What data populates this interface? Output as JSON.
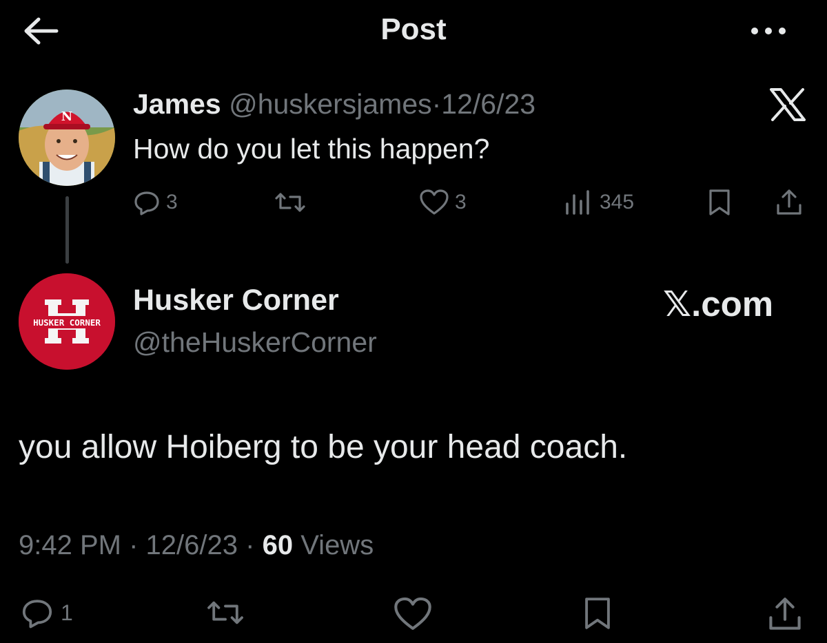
{
  "header": {
    "title": "Post",
    "back_icon": "arrow-left-icon",
    "more_icon": "more-horizontal-icon"
  },
  "parent_tweet": {
    "avatar_icon": "cartoon-avatar-icon",
    "author_name": "James",
    "handle": "@huskersjames",
    "separator": "·",
    "date": "12/6/23",
    "text": "How do you let this happen?",
    "replies": "3",
    "likes": "3",
    "views": "345",
    "platform_logo": "X"
  },
  "main_tweet": {
    "author_name": "Husker Corner",
    "handle": "@theHuskerCorner",
    "avatar_text": "HUSKER CORNER",
    "avatar_letter": "H",
    "watermark": "𝕏.com",
    "text": "you allow Hoiberg to be your head coach.",
    "time": "9:42 PM",
    "separator": "·",
    "date": "12/6/23",
    "views_count": "60",
    "views_label": "Views",
    "replies": "1"
  },
  "colors": {
    "background": "#000000",
    "text": "#e7e9ea",
    "muted": "#71767b",
    "brand_red": "#c8102e"
  }
}
